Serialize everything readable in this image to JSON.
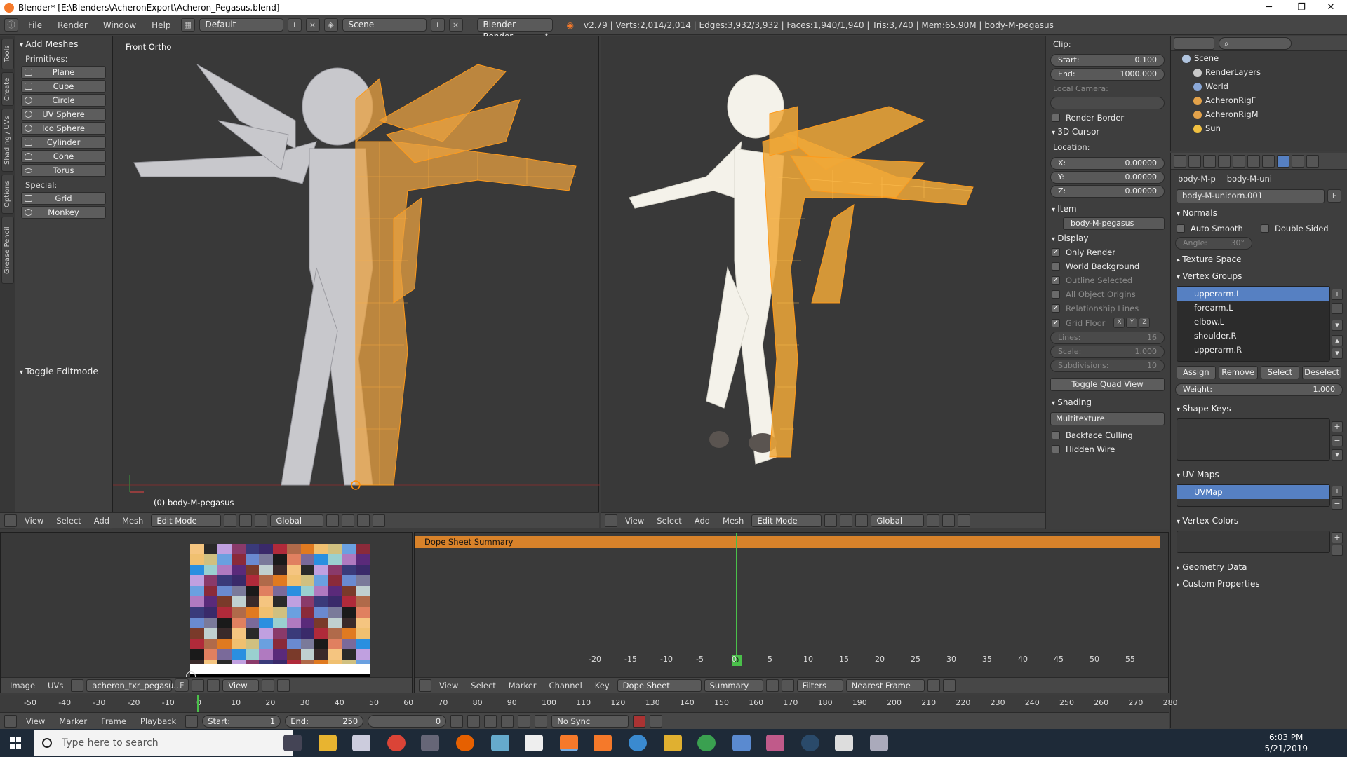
{
  "titlebar": {
    "title": "Blender* [E:\\Blenders\\AcheronExport\\Acheron_Pegasus.blend]"
  },
  "info": {
    "menus": [
      "File",
      "Render",
      "Window",
      "Help"
    ],
    "layout": "Default",
    "scene": "Scene",
    "engine": "Blender Render",
    "stats": "v2.79 | Verts:2,014/2,014 | Edges:3,932/3,932 | Faces:1,940/1,940 | Tris:3,740 | Mem:65.90M | body-M-pegasus"
  },
  "tabs": [
    "Tools",
    "Create",
    "Shading / UVs",
    "Options",
    "Grease Pencil"
  ],
  "toolshelf": {
    "header": "Add Meshes",
    "primitives_label": "Primitives:",
    "primitives": [
      "Plane",
      "Cube",
      "Circle",
      "UV Sphere",
      "Ico Sphere",
      "Cylinder",
      "Cone",
      "Torus"
    ],
    "special_label": "Special:",
    "special": [
      "Grid",
      "Monkey"
    ],
    "operator": "Toggle Editmode"
  },
  "viewport_left": {
    "label": "Front Ortho",
    "object_label": "(0) body-M-pegasus"
  },
  "viewport_header": {
    "menus": [
      "View",
      "Select",
      "Add",
      "Mesh"
    ],
    "mode": "Edit Mode",
    "orientation": "Global"
  },
  "npanel": {
    "clip_label": "Clip:",
    "clip_start": {
      "label": "Start:",
      "value": "0.100"
    },
    "clip_end": {
      "label": "End:",
      "value": "1000.000"
    },
    "local_camera": "Local Camera:",
    "render_border": "Render Border",
    "cursor_header": "3D Cursor",
    "location_label": "Location:",
    "x": {
      "label": "X:",
      "value": "0.00000"
    },
    "y": {
      "label": "Y:",
      "value": "0.00000"
    },
    "z": {
      "label": "Z:",
      "value": "0.00000"
    },
    "item_header": "Item",
    "item_name": "body-M-pegasus",
    "display_header": "Display",
    "only_render": "Only Render",
    "world_background": "World Background",
    "outline_selected": "Outline Selected",
    "all_object_origins": "All Object Origins",
    "relationship_lines": "Relationship Lines",
    "grid_floor": "Grid Floor",
    "axes": [
      "X",
      "Y",
      "Z"
    ],
    "lines": {
      "label": "Lines:",
      "value": "16"
    },
    "scale": {
      "label": "Scale:",
      "value": "1.000"
    },
    "subdivisions": {
      "label": "Subdivisions:",
      "value": "10"
    },
    "toggle_quad": "Toggle Quad View",
    "shading_header": "Shading",
    "shading_mode": "Multitexture",
    "backface_culling": "Backface Culling",
    "hidden_wire": "Hidden Wire"
  },
  "outliner": {
    "items": [
      {
        "label": "Scene",
        "color": "#b0c4de"
      },
      {
        "label": "RenderLayers",
        "color": "#c8c8c8"
      },
      {
        "label": "World",
        "color": "#8aa8d8"
      },
      {
        "label": "AcheronRigF",
        "color": "#e3a24a"
      },
      {
        "label": "AcheronRigM",
        "color": "#e3a24a"
      },
      {
        "label": "Sun",
        "color": "#f0c040"
      }
    ]
  },
  "properties": {
    "breadcrumb": [
      "body-M-p",
      "body-M-uni"
    ],
    "mesh_name": "body-M-unicorn.001",
    "fake_user": "F",
    "normals": "Normals",
    "auto_smooth": "Auto Smooth",
    "double_sided": "Double Sided",
    "angle": {
      "label": "Angle:",
      "value": "30°"
    },
    "texture_space": "Texture Space",
    "vertex_groups": "Vertex Groups",
    "groups": [
      "upperarm.L",
      "forearm.L",
      "elbow.L",
      "shoulder.R",
      "upperarm.R"
    ],
    "assign": "Assign",
    "remove": "Remove",
    "select": "Select",
    "deselect": "Deselect",
    "weight": {
      "label": "Weight:",
      "value": "1.000"
    },
    "shape_keys": "Shape Keys",
    "uv_maps": "UV Maps",
    "uv_map_name": "UVMap",
    "vertex_colors": "Vertex Colors",
    "geometry_data": "Geometry Data",
    "custom_properties": "Custom Properties"
  },
  "uv_editor": {
    "menus": [
      "Image",
      "UVs"
    ],
    "image_name": "acheron_txr_pegasu...",
    "view": "View",
    "fake": "F",
    "palette": [
      "#f5c580",
      "#2a8fe0",
      "#6aa0e0",
      "#3a3a7a",
      "#7a3a2a",
      "#1a1a1a",
      "#e07a20",
      "#2a2a2a",
      "#9ad0d0",
      "#8a2a3a",
      "#3a2a6a",
      "#c0d0d0",
      "#e08060",
      "#f0c070",
      "#c0a0e0",
      "#b07ac0",
      "#6a8ad0",
      "#b02a3a",
      "#3a2a2a",
      "#7a6a9a",
      "#d0c080",
      "#8a3a6a",
      "#5a2a7a",
      "#7a7a9a",
      "#b06a4a"
    ]
  },
  "dope": {
    "summary": "Dope Sheet Summary",
    "current_frame": "0",
    "ticks": [
      "-20",
      "-15",
      "-10",
      "-5",
      "0",
      "5",
      "10",
      "15",
      "20",
      "25",
      "30",
      "35",
      "40",
      "45",
      "50",
      "55"
    ],
    "menus": [
      "View",
      "Select",
      "Marker",
      "Channel",
      "Key"
    ],
    "mode": "Dope Sheet",
    "summary_btn": "Summary",
    "filters": "Filters",
    "snap": "Nearest Frame"
  },
  "timeline": {
    "ticks": [
      "-50",
      "-40",
      "-30",
      "-20",
      "-10",
      "0",
      "10",
      "20",
      "30",
      "40",
      "50",
      "60",
      "70",
      "80",
      "90",
      "100",
      "110",
      "120",
      "130",
      "140",
      "150",
      "160",
      "170",
      "180",
      "190",
      "200",
      "210",
      "220",
      "230",
      "240",
      "250",
      "260",
      "270",
      "280"
    ],
    "menus": [
      "View",
      "Marker",
      "Frame",
      "Playback"
    ],
    "start": {
      "label": "Start:",
      "value": "1"
    },
    "end": {
      "label": "End:",
      "value": "250"
    },
    "current": "0",
    "sync": "No Sync"
  },
  "taskbar": {
    "search_placeholder": "Type here to search",
    "time": "6:03 PM",
    "date": "5/21/2019"
  }
}
